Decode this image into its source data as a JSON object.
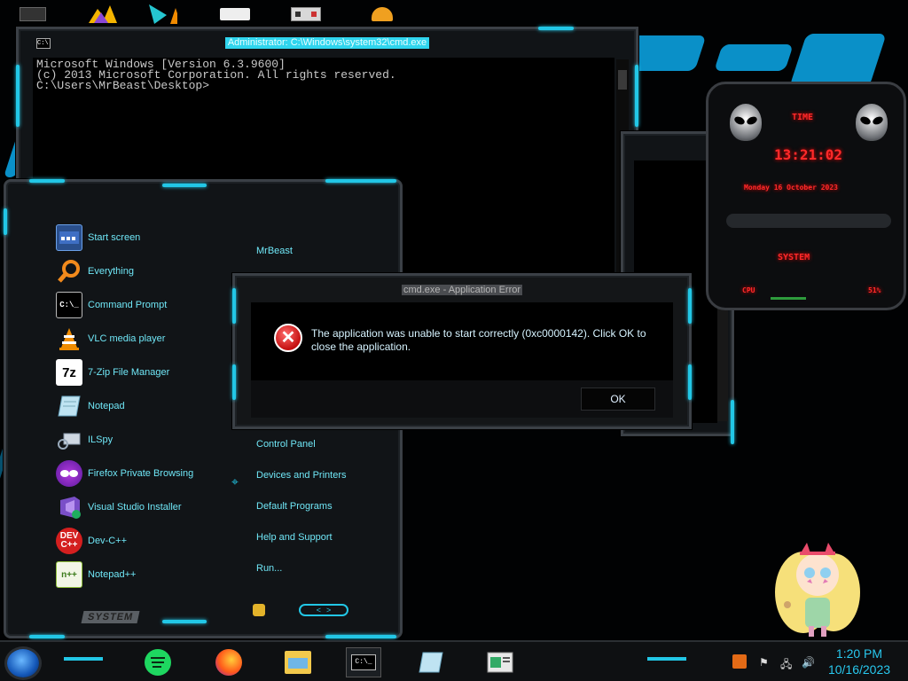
{
  "cmd": {
    "title": "Administrator: C:\\Windows\\system32\\cmd.exe",
    "lines": [
      "Microsoft Windows [Version 6.3.9600]",
      "(c) 2013 Microsoft Corporation. All rights reserved.",
      "",
      "C:\\Users\\MrBeast\\Desktop>"
    ]
  },
  "start_menu": {
    "apps": [
      {
        "label": "Start screen",
        "icon": "start-screen-icon"
      },
      {
        "label": "Everything",
        "icon": "search-magnifier-icon"
      },
      {
        "label": "Command Prompt",
        "icon": "cmd-icon"
      },
      {
        "label": "VLC media player",
        "icon": "vlc-cone-icon"
      },
      {
        "label": "7-Zip File Manager",
        "icon": "7zip-icon"
      },
      {
        "label": "Notepad",
        "icon": "notepad-icon"
      },
      {
        "label": "ILSpy",
        "icon": "ilspy-icon"
      },
      {
        "label": "Firefox Private Browsing",
        "icon": "firefox-private-icon"
      },
      {
        "label": "Visual Studio Installer",
        "icon": "visual-studio-icon"
      },
      {
        "label": "Dev-C++",
        "icon": "devcpp-icon"
      },
      {
        "label": "Notepad++",
        "icon": "notepadpp-icon"
      }
    ],
    "right_items": [
      "MrBeast",
      "Control Panel",
      "Devices and Printers",
      "Default Programs",
      "Help and Support",
      "Run..."
    ],
    "system_label": "SYSTEM",
    "nav_prev": "<",
    "nav_next": ">"
  },
  "dialog": {
    "title": "cmd.exe - Application Error",
    "message": "The application was unable to start correctly (0xc0000142). Click OK to close the application.",
    "ok_label": "OK"
  },
  "gadget": {
    "time_label": "TIME",
    "time": "13:21:02",
    "date": "Monday 16 October 2023",
    "system_label": "SYSTEM",
    "cpu_label": "CPU",
    "ram_value": "51%"
  },
  "taskbar": {
    "time": "1:20 PM",
    "date": "10/16/2023"
  },
  "colors": {
    "accent_cyan": "#22c7e6",
    "error_red": "#c40f0f",
    "gadget_red": "#ff2a2a"
  }
}
